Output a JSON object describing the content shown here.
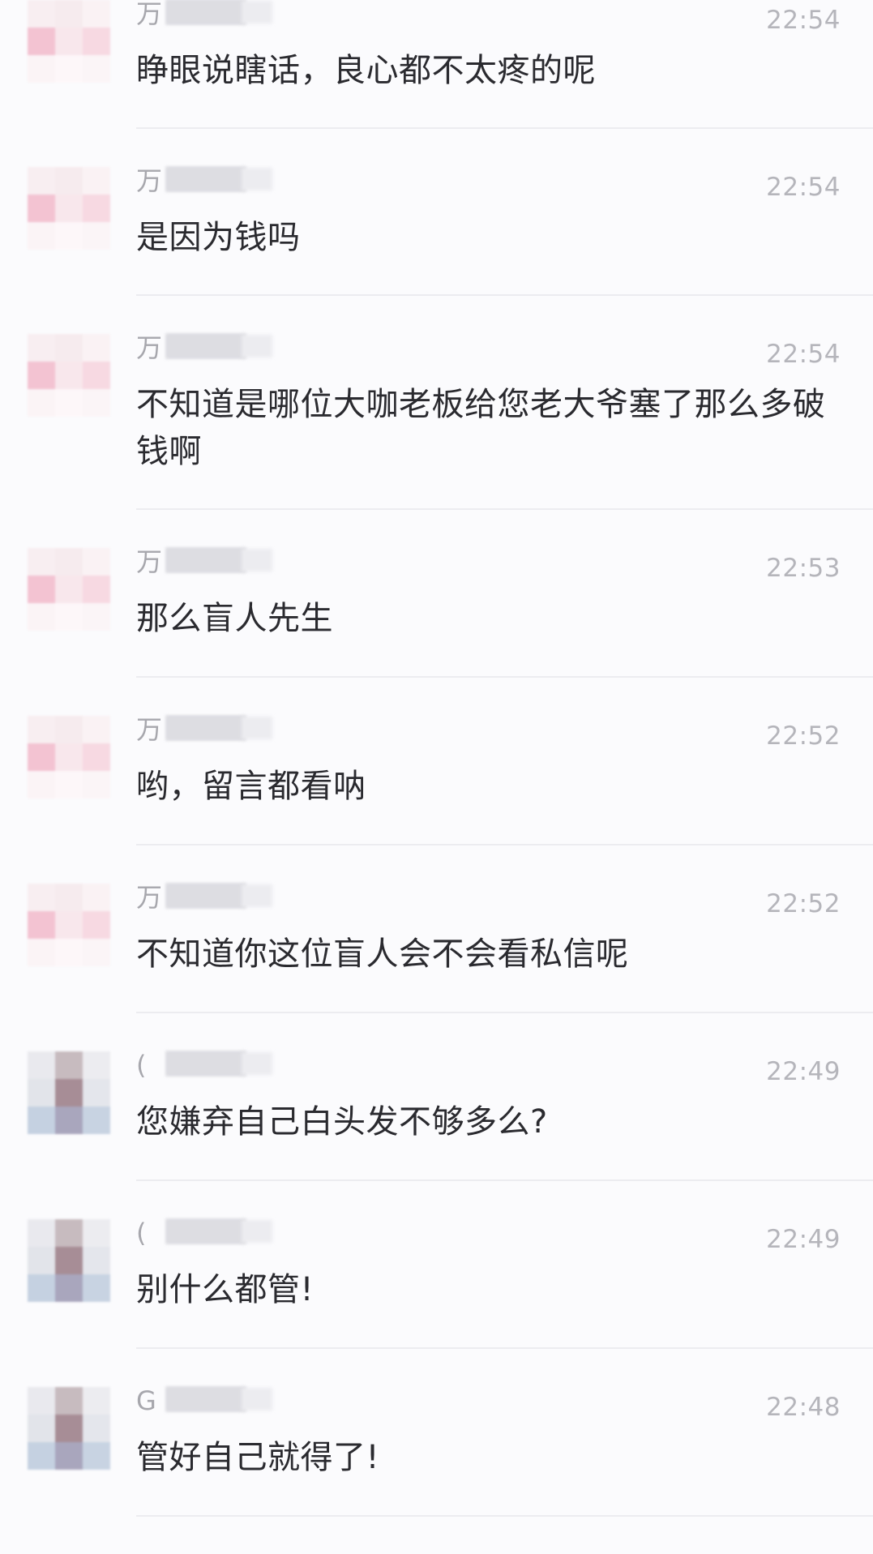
{
  "messages": [
    {
      "name_initial": "万",
      "time": "22:54",
      "text": "睁眼说瞎话，良心都不太疼的呢",
      "avatar": "pink"
    },
    {
      "name_initial": "万",
      "time": "22:54",
      "text": "是因为钱吗",
      "avatar": "pink"
    },
    {
      "name_initial": "万",
      "time": "22:54",
      "text": "不知道是哪位大咖老板给您老大爷塞了那么多破钱啊",
      "avatar": "pink"
    },
    {
      "name_initial": "万",
      "time": "22:53",
      "text": "那么盲人先生",
      "avatar": "pink"
    },
    {
      "name_initial": "万",
      "time": "22:52",
      "text": "哟，留言都看呐",
      "avatar": "pink"
    },
    {
      "name_initial": "万",
      "time": "22:52",
      "text": "不知道你这位盲人会不会看私信呢",
      "avatar": "pink"
    },
    {
      "name_initial": "(",
      "time": "22:49",
      "text": "您嫌弃自己白头发不够多么?",
      "avatar": "gray"
    },
    {
      "name_initial": "(",
      "time": "22:49",
      "text": "别什么都管!",
      "avatar": "gray"
    },
    {
      "name_initial": "G",
      "time": "22:48",
      "text": "管好自己就得了!",
      "avatar": "gray"
    }
  ]
}
